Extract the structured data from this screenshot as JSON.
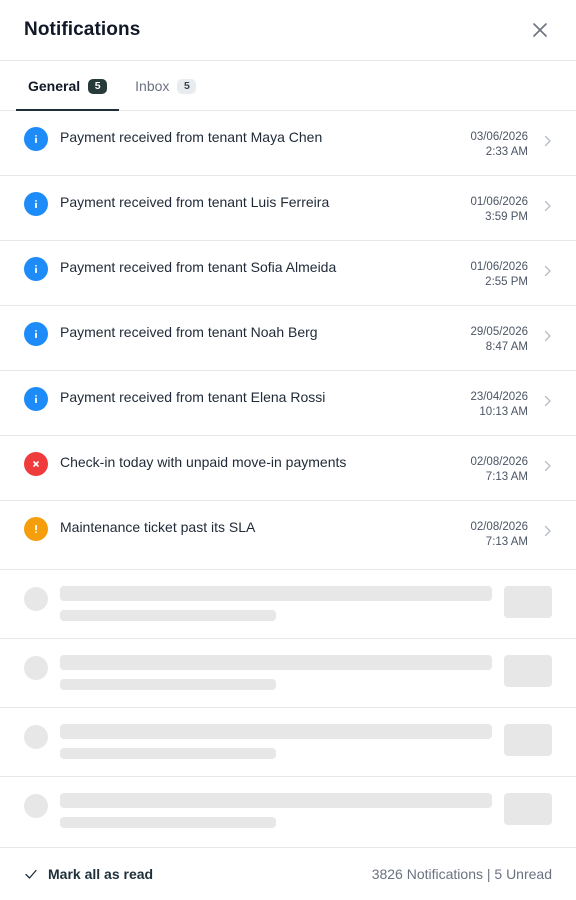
{
  "header": {
    "title": "Notifications"
  },
  "tabs": [
    {
      "label": "General",
      "count": "5",
      "active": true
    },
    {
      "label": "Inbox",
      "count": "5",
      "active": false
    }
  ],
  "notifications": [
    {
      "type": "info",
      "icon": "info-icon",
      "message": "Payment received from tenant Maya Chen",
      "date": "03/06/2026",
      "time": "2:33 AM"
    },
    {
      "type": "info",
      "icon": "info-icon",
      "message": "Payment received from tenant Luis Ferreira",
      "date": "01/06/2026",
      "time": "3:59 PM"
    },
    {
      "type": "info",
      "icon": "info-icon",
      "message": "Payment received from tenant Sofia Almeida",
      "date": "01/06/2026",
      "time": "2:55 PM"
    },
    {
      "type": "info",
      "icon": "info-icon",
      "message": "Payment received from tenant Noah Berg",
      "date": "29/05/2026",
      "time": "8:47 AM"
    },
    {
      "type": "info",
      "icon": "info-icon",
      "message": "Payment received from tenant Elena Rossi",
      "date": "23/04/2026",
      "time": "10:13 AM"
    },
    {
      "type": "error",
      "icon": "error-icon",
      "message": "Check-in today with unpaid move-in payments",
      "date": "02/08/2026",
      "time": "7:13 AM"
    },
    {
      "type": "warn",
      "icon": "warning-icon",
      "message": "Maintenance ticket past its SLA",
      "date": "02/08/2026",
      "time": "7:13 AM"
    }
  ],
  "footer": {
    "mark_all_label": "Mark all as read",
    "summary": "3826 Notifications | 5 Unread"
  },
  "colors": {
    "info": "#1d8cf8",
    "error": "#ef3b3b",
    "warn": "#f59e0b",
    "accent": "#1f2f3a"
  }
}
